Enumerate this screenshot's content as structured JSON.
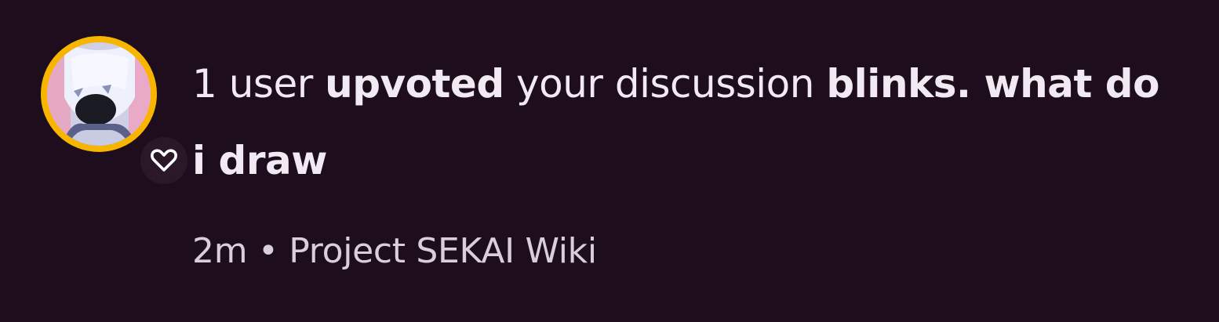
{
  "notification": {
    "count_text": "1 user",
    "action": "upvoted",
    "middle_text": "your discussion",
    "discussion_title": "blinks. what do i draw",
    "time": "2m",
    "separator": "•",
    "wiki": "Project SEKAI Wiki"
  },
  "icons": {
    "badge": "heart-icon",
    "avatar": "user-avatar"
  },
  "colors": {
    "background": "#1e0e1d",
    "avatar_ring": "#f7b500",
    "text": "#f2eaf2",
    "meta_text": "#d9cfd9"
  }
}
